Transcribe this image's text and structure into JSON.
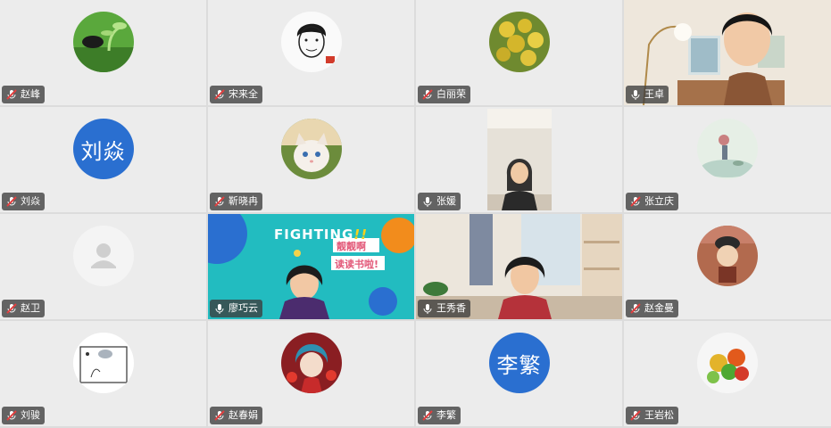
{
  "participants": [
    {
      "name": "赵峰",
      "mic": "muted"
    },
    {
      "name": "宋来全",
      "mic": "muted"
    },
    {
      "name": "白丽荣",
      "mic": "muted"
    },
    {
      "name": "王卓",
      "mic": "on"
    },
    {
      "name": "刘焱",
      "mic": "muted",
      "avatar_text": "刘焱"
    },
    {
      "name": "靳晓冉",
      "mic": "muted"
    },
    {
      "name": "张媛",
      "mic": "on"
    },
    {
      "name": "张立庆",
      "mic": "muted"
    },
    {
      "name": "赵卫",
      "mic": "muted"
    },
    {
      "name": "廖巧云",
      "mic": "on"
    },
    {
      "name": "王秀香",
      "mic": "on"
    },
    {
      "name": "赵金曼",
      "mic": "muted"
    },
    {
      "name": "刘骏",
      "mic": "muted"
    },
    {
      "name": "赵春娟",
      "mic": "muted"
    },
    {
      "name": "李繁",
      "mic": "muted",
      "avatar_text": "李繁"
    },
    {
      "name": "王岩松",
      "mic": "muted"
    }
  ],
  "banner": {
    "fighting": "FIGHTING",
    "exclaim": "!!",
    "line1": "靓靓啊",
    "line2": "读读书啦!"
  },
  "colors": {
    "active_border": "#3ec58c",
    "text_avatar_bg": "#2a6fd0",
    "tag_bg": "#3c3c3c"
  }
}
